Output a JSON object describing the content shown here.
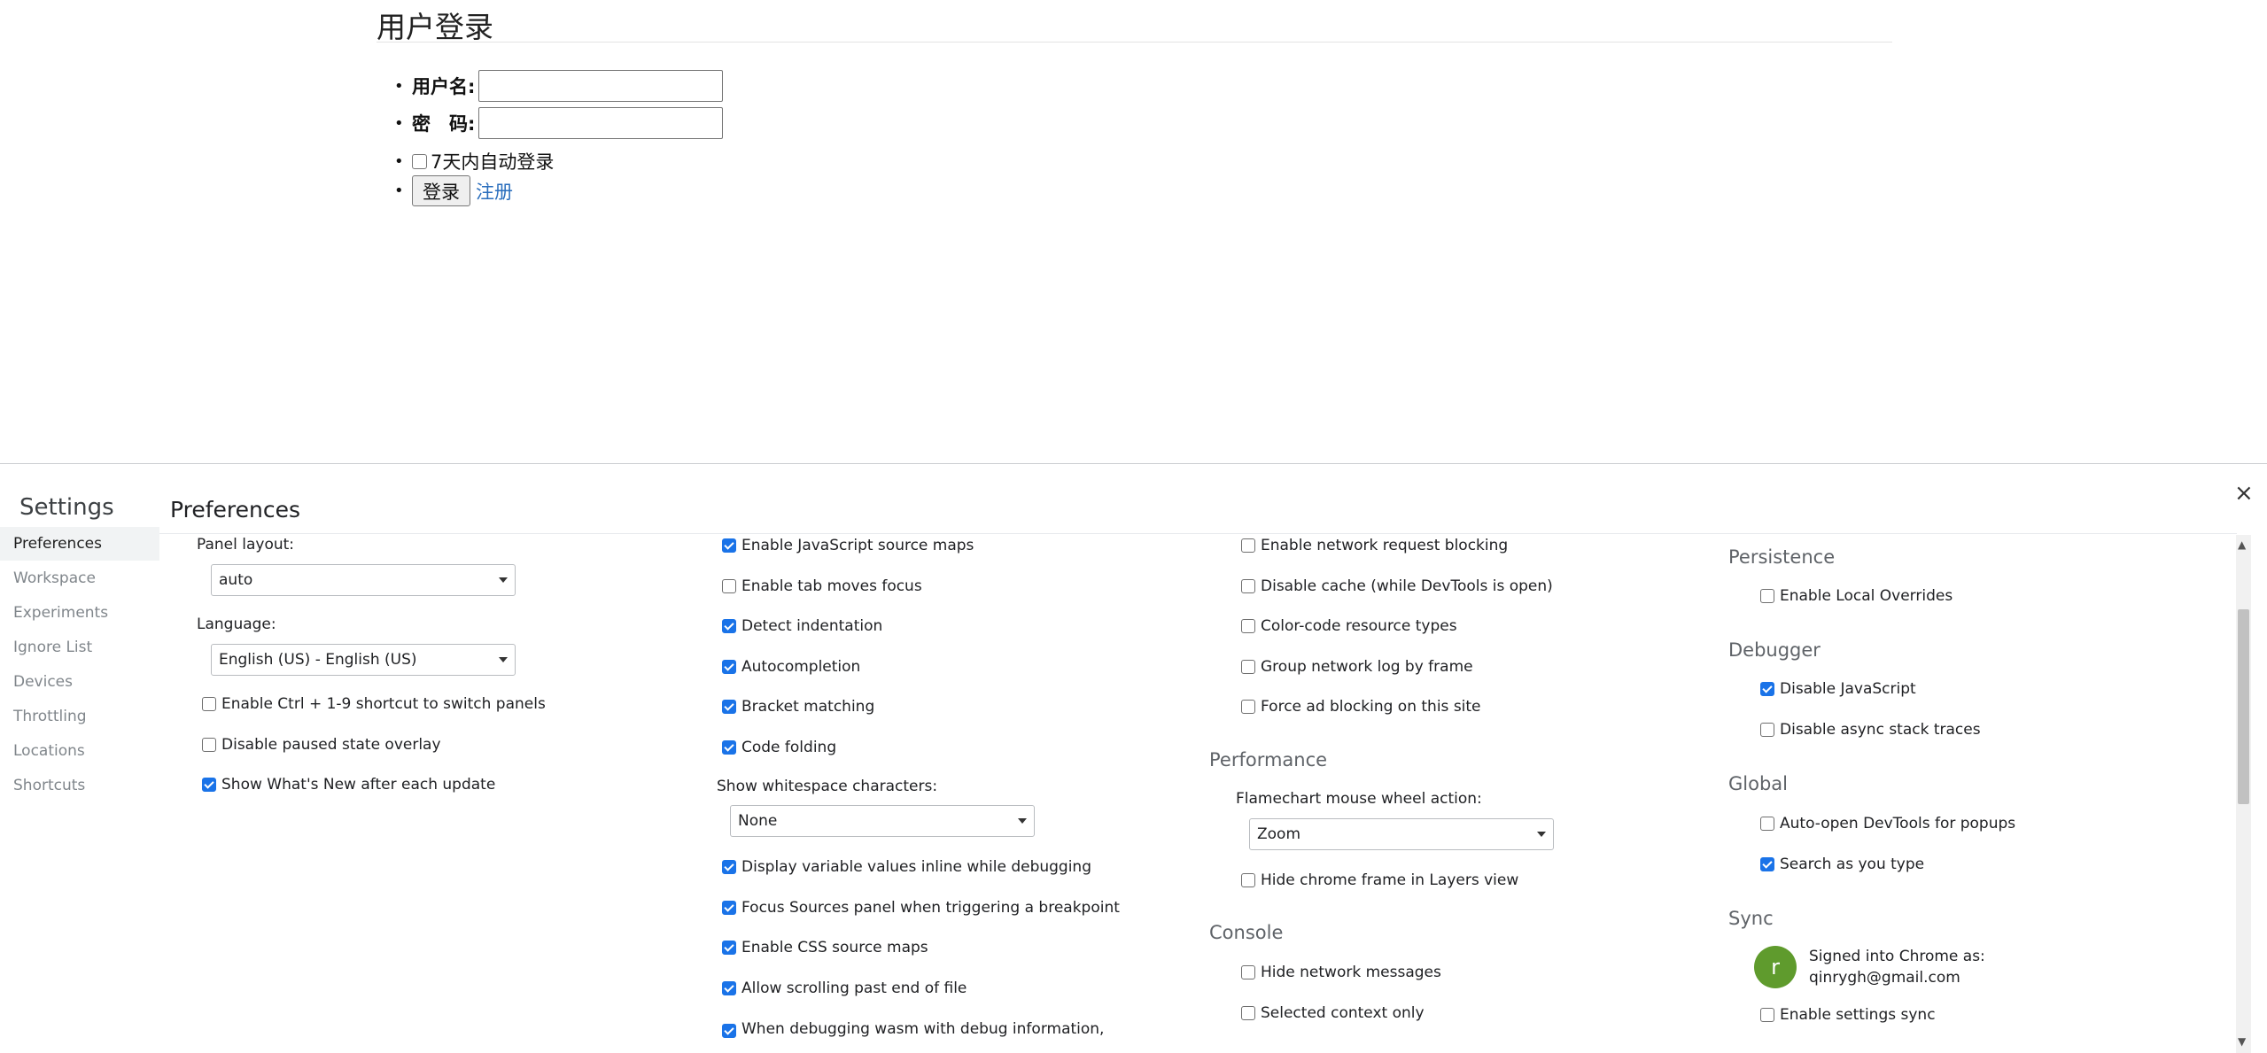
{
  "page": {
    "title": "用户登录",
    "username_label": "用户名:",
    "password_label": "密　码:",
    "remember_label": "7天内自动登录",
    "login_button": "登录",
    "register_link": "注册"
  },
  "devtools": {
    "settings_title": "Settings",
    "preferences_title": "Preferences",
    "sidebar": [
      "Preferences",
      "Workspace",
      "Experiments",
      "Ignore List",
      "Devices",
      "Throttling",
      "Locations",
      "Shortcuts"
    ],
    "col1": {
      "panel_layout_label": "Panel layout:",
      "panel_layout_value": "auto",
      "language_label": "Language:",
      "language_value": "English (US) - English (US)",
      "checks": [
        {
          "label": "Enable Ctrl + 1-9 shortcut to switch panels",
          "checked": false
        },
        {
          "label": "Disable paused state overlay",
          "checked": false
        },
        {
          "label": "Show What's New after each update",
          "checked": true
        }
      ]
    },
    "col2": {
      "checks_top": [
        {
          "label": "Enable JavaScript source maps",
          "checked": true
        },
        {
          "label": "Enable tab moves focus",
          "checked": false
        },
        {
          "label": "Detect indentation",
          "checked": true
        },
        {
          "label": "Autocompletion",
          "checked": true
        },
        {
          "label": "Bracket matching",
          "checked": true
        },
        {
          "label": "Code folding",
          "checked": true
        }
      ],
      "whitespace_label": "Show whitespace characters:",
      "whitespace_value": "None",
      "checks_bottom": [
        {
          "label": "Display variable values inline while debugging",
          "checked": true
        },
        {
          "label": "Focus Sources panel when triggering a breakpoint",
          "checked": true
        },
        {
          "label": "Enable CSS source maps",
          "checked": true
        },
        {
          "label": "Allow scrolling past end of file",
          "checked": true
        },
        {
          "label": "When debugging wasm with debug information,",
          "checked": true
        }
      ]
    },
    "col3": {
      "checks_network": [
        {
          "label": "Enable network request blocking",
          "checked": false
        },
        {
          "label": "Disable cache (while DevTools is open)",
          "checked": false
        },
        {
          "label": "Color-code resource types",
          "checked": false
        },
        {
          "label": "Group network log by frame",
          "checked": false
        },
        {
          "label": "Force ad blocking on this site",
          "checked": false
        }
      ],
      "performance_title": "Performance",
      "flamechart_label": "Flamechart mouse wheel action:",
      "flamechart_value": "Zoom",
      "hide_chrome_frame": {
        "label": "Hide chrome frame in Layers view",
        "checked": false
      },
      "console_title": "Console",
      "console_checks": [
        {
          "label": "Hide network messages",
          "checked": false
        },
        {
          "label": "Selected context only",
          "checked": false
        }
      ]
    },
    "col4": {
      "persistence_title": "Persistence",
      "local_overrides": {
        "label": "Enable Local Overrides",
        "checked": false
      },
      "debugger_title": "Debugger",
      "debugger_checks": [
        {
          "label": "Disable JavaScript",
          "checked": true
        },
        {
          "label": "Disable async stack traces",
          "checked": false
        }
      ],
      "global_title": "Global",
      "global_checks": [
        {
          "label": "Auto-open DevTools for popups",
          "checked": false
        },
        {
          "label": "Search as you type",
          "checked": true
        }
      ],
      "sync_title": "Sync",
      "avatar_letter": "r",
      "signed_in_label": "Signed into Chrome as:",
      "signed_in_email": "qinrygh@gmail.com",
      "settings_sync": {
        "label": "Enable settings sync",
        "checked": false
      }
    },
    "close_icon": "×",
    "accent_color": "#1a73e8"
  }
}
